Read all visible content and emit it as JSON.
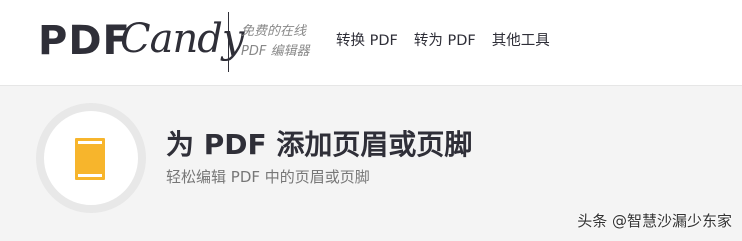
{
  "header": {
    "logo": {
      "part1": "PDF",
      "part2": "Candy"
    },
    "tagline": {
      "line1": "免费的在线",
      "line2": "PDF 编辑器"
    },
    "nav": [
      {
        "label": "转换 PDF"
      },
      {
        "label": "转为 PDF"
      },
      {
        "label": "其他工具"
      }
    ]
  },
  "hero": {
    "icon": "document-icon",
    "title": "为 PDF 添加页眉或页脚",
    "subtitle": "轻松编辑 PDF 中的页眉或页脚"
  },
  "watermark": "头条 @智慧沙漏少东家",
  "colors": {
    "brand_dark": "#2f2f38",
    "accent_yellow": "#f7b52c",
    "background": "#f4f4f4",
    "header_bg": "#ffffff"
  }
}
